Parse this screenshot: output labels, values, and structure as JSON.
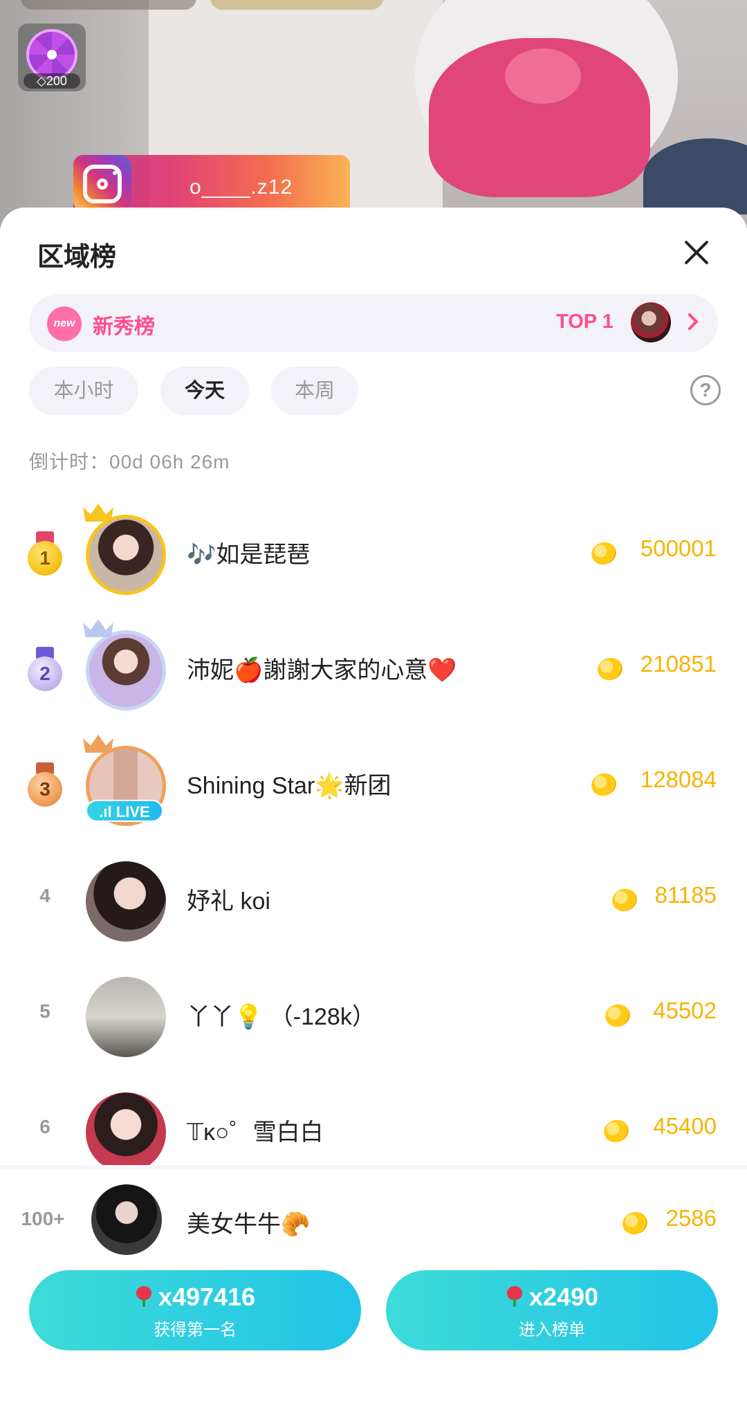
{
  "stream": {
    "wheel_badge_value": "200",
    "instagram_handle": "o____.z12"
  },
  "sheet": {
    "title": "区域榜",
    "newbie_bar": {
      "badge": "new",
      "label": "新秀榜",
      "top_label": "TOP 1"
    },
    "tabs": [
      {
        "label": "本小时",
        "active": false
      },
      {
        "label": "今天",
        "active": true
      },
      {
        "label": "本周",
        "active": false
      }
    ],
    "help_symbol": "?",
    "countdown": "倒计时：00d 06h 26m"
  },
  "ranking": [
    {
      "rank": "1",
      "name": "🎶如是琵琶",
      "score": "500001",
      "medal_color": "#f7c51e",
      "crown": "gold",
      "live": false
    },
    {
      "rank": "2",
      "name": "沛妮🍎謝謝大家的心意❤️",
      "score": "210851",
      "medal_color": "#c9b9f0",
      "crown": "silver",
      "live": false
    },
    {
      "rank": "3",
      "name": "Shining Star🌟新团",
      "score": "128084",
      "medal_color": "#f0a05a",
      "crown": "bronze",
      "live": true,
      "live_label": "LIVE"
    },
    {
      "rank": "4",
      "name": "妤礼 koi",
      "score": "81185"
    },
    {
      "rank": "5",
      "name": "丫丫💡 （-128k）",
      "score": "45502"
    },
    {
      "rank": "6",
      "name": "𝕋ĸ○゜雪白白",
      "score": "45400"
    }
  ],
  "self_row": {
    "rank": "100+",
    "name": "美女牛牛🥐",
    "score": "2586"
  },
  "actions": [
    {
      "amount": "x497416",
      "label": "获得第一名"
    },
    {
      "amount": "x2490",
      "label": "进入榜单"
    }
  ],
  "colors": {
    "accent_pink": "#ff4e8c",
    "score_gold": "#f5b400",
    "button_teal": "#22c4e8"
  }
}
